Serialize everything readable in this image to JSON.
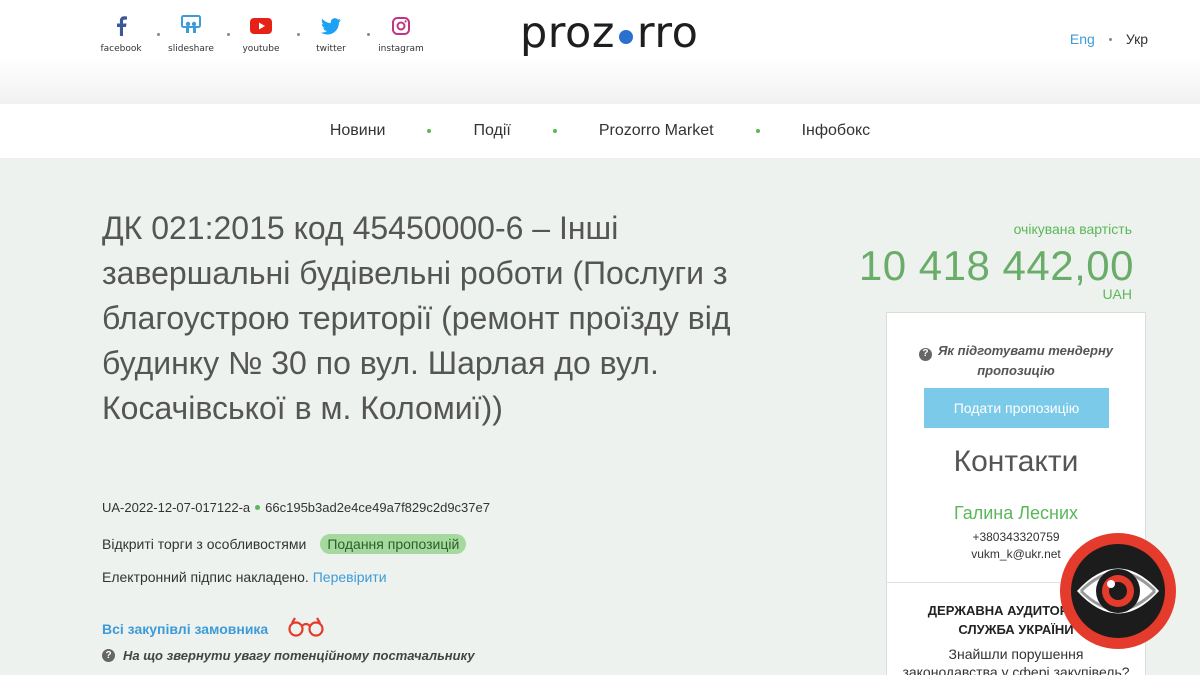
{
  "social": [
    {
      "label": "facebook",
      "icon": "facebook-icon",
      "color": "#3b5998"
    },
    {
      "label": "slideshare",
      "icon": "slideshare-icon",
      "color": "#3d9bd8"
    },
    {
      "label": "youtube",
      "icon": "youtube-icon",
      "color": "#e62117"
    },
    {
      "label": "twitter",
      "icon": "twitter-icon",
      "color": "#1da1f2"
    },
    {
      "label": "instagram",
      "icon": "instagram-icon",
      "color": "#c13584"
    }
  ],
  "logo": {
    "left": "proz",
    "right": "rro",
    "dot_color": "#2b6fd1"
  },
  "lang": {
    "en": "Eng",
    "uk": "Укр"
  },
  "nav": {
    "items": [
      "Новини",
      "Події",
      "Prozorro Market",
      "Інфобокс"
    ]
  },
  "tender": {
    "title": "ДК 021:2015 код 45450000-6 – Інші завершальні будівельні роботи (Послуги з благоустрою території (ремонт проїзду від будинку № 30 по вул. Шарлая до вул. Косачівської в м. Коломиї))",
    "id": "UA-2022-12-07-017122-a",
    "hash": "66c195b3ad2e4ce49a7f829c2d9c37e7",
    "procedure": "Відкриті торги з особливостями",
    "status": "Подання пропозицій",
    "signature_text": "Електронний підпис накладено.",
    "signature_link": "Перевірити",
    "all_purchases": "Всі закупівлі замовника",
    "attention": "На що звернути увагу потенційному постачальнику"
  },
  "expected": {
    "label": "очікувана вартість",
    "value": "10 418 442,00",
    "currency": "UAH"
  },
  "card": {
    "howto": "Як підготувати тендерну пропозицію",
    "submit": "Подати пропозицію",
    "contacts_title": "Контакти",
    "name": "Галина Лесних",
    "phone": "+380343320759",
    "email": "vukm_k@ukr.net",
    "audit_title_1": "ДЕРЖАВНА АУДИТОРСЬКА",
    "audit_title_2": "СЛУЖБА УКРАЇНИ",
    "audit_text_1": "Знайшли порушення",
    "audit_text_2": "законодавства у сфері закупівель?"
  },
  "colors": {
    "accent_green": "#5ab75a",
    "link_blue": "#3d9bd8",
    "button_blue": "#7ccaea",
    "eye_red": "#e43b2c"
  }
}
